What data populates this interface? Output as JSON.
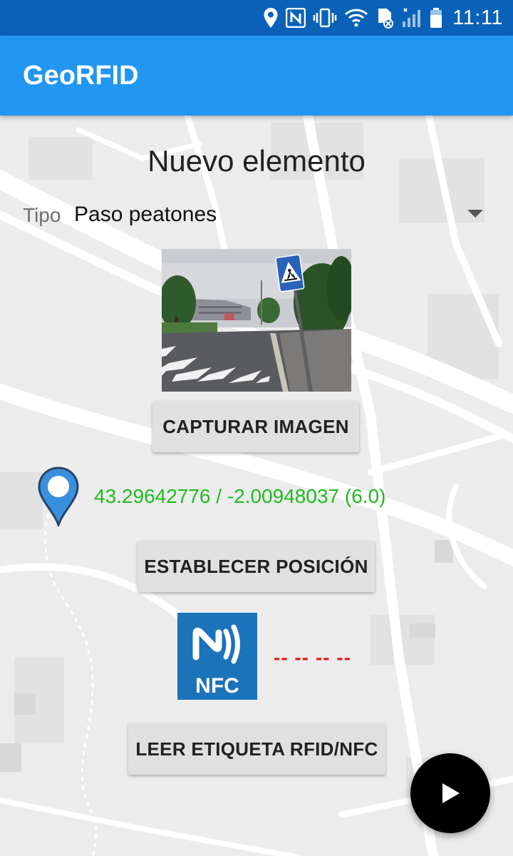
{
  "status_bar": {
    "time": "11:11",
    "icons": [
      "location-icon",
      "nfc-status-icon",
      "vibrate-icon",
      "wifi-icon",
      "sd-card-icon",
      "signal-icon",
      "battery-icon"
    ]
  },
  "app_bar": {
    "title": "GeoRFID"
  },
  "form": {
    "heading": "Nuevo elemento",
    "tipo_label": "Tipo",
    "tipo_value": "Paso peatones",
    "capture_button": "CAPTURAR IMAGEN",
    "coordinates": "43.29642776 / -2.00948037 (6.0)",
    "set_position_button": "ESTABLECER POSICIÓN",
    "nfc_logo_text": "NFC",
    "tag_value": "-- -- -- --",
    "read_tag_button": "LEER ETIQUETA RFID/NFC"
  },
  "colors": {
    "status_bar": "#0a62b8",
    "app_bar": "#2196f3",
    "coordinates_text": "#1fbb1f",
    "tag_value_text": "#e82020",
    "button_bg": "#e0e0e0",
    "fab_bg": "#000000",
    "nfc_logo_bg": "#1b73ba",
    "pin_color": "#3a8fdc"
  },
  "fab": {
    "icon": "play-icon"
  }
}
